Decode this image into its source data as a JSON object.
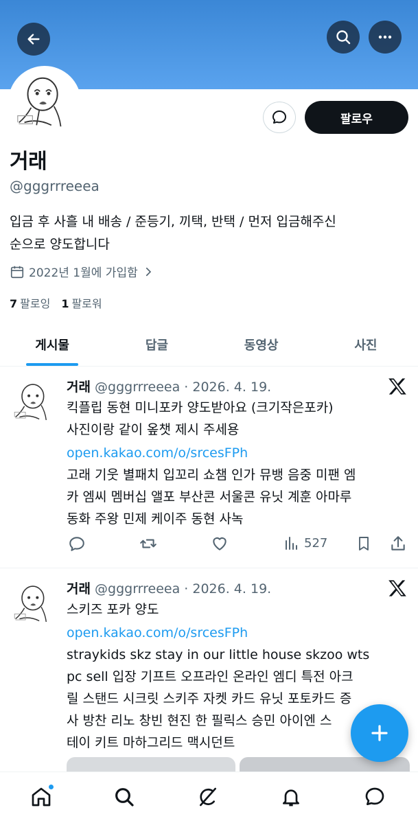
{
  "profile": {
    "name": "거래",
    "handle": "@gggrrreeea",
    "bio_line1": "입금 후 사흘 내 배송 / 준등기, 끼택, 반택 / 먼저 입금해주신",
    "bio_line2": "순으로 양도합니다",
    "joined": "2022년 1월에 가입함",
    "following_count": "7",
    "following_label": "팔로잉",
    "followers_count": "1",
    "followers_label": "팔로워",
    "follow_label": "팔로우"
  },
  "tabs": [
    {
      "label": "게시물",
      "active": true
    },
    {
      "label": "답글",
      "active": false
    },
    {
      "label": "동영상",
      "active": false
    },
    {
      "label": "사진",
      "active": false
    }
  ],
  "posts": [
    {
      "name": "거래",
      "meta": "@gggrrreeea · 2026. 4. 19.",
      "lines": [
        "킥플립 동현 미니포카 양도받아요 (크기작은포카)",
        "사진이랑 같이 옾챗 제시 주세용"
      ],
      "link": "open.kakao.com/o/srcesFPh",
      "tags": [
        "고래 기웃 별패치 입꼬리 쇼챔 인가 뮤뱅 음중 미팬 엠",
        "카 엠씨 멤버십 앨포 부산콘 서울콘 유닛 계훈 아마루",
        "동화 주왕 민제 케이주 동현 사녹"
      ],
      "views": "527"
    },
    {
      "name": "거래",
      "meta": "@gggrrreeea · 2026. 4. 19.",
      "lines": [
        "스키즈 포카 양도"
      ],
      "link": "open.kakao.com/o/srcesFPh",
      "tags": [
        "straykids skz stay in our little house skzoo wts",
        "pc sell 입장 기프트 오프라인 온라인 엠디 특전 아크",
        "릴 스탠드 시크릿 스키주 자켓 카드 유닛 포토카드 증",
        "사 방찬 리노 창빈 현진 한 필릭스 승민 아이엔 스",
        "테이 키트 마하그리드 맥시던트"
      ]
    }
  ],
  "colors": {
    "accent": "#1d9bf0",
    "banner": "#4a96e3",
    "text": "#0f1419",
    "muted": "#536471"
  },
  "icons": [
    "back-arrow-icon",
    "search-icon",
    "more-icon",
    "message-icon",
    "calendar-icon",
    "chevron-right-icon",
    "x-logo-icon",
    "reply-icon",
    "retweet-icon",
    "like-icon",
    "views-icon",
    "bookmark-icon",
    "share-icon",
    "plus-icon",
    "home-icon",
    "explore-icon",
    "grok-icon",
    "notifications-icon",
    "messages-icon"
  ]
}
